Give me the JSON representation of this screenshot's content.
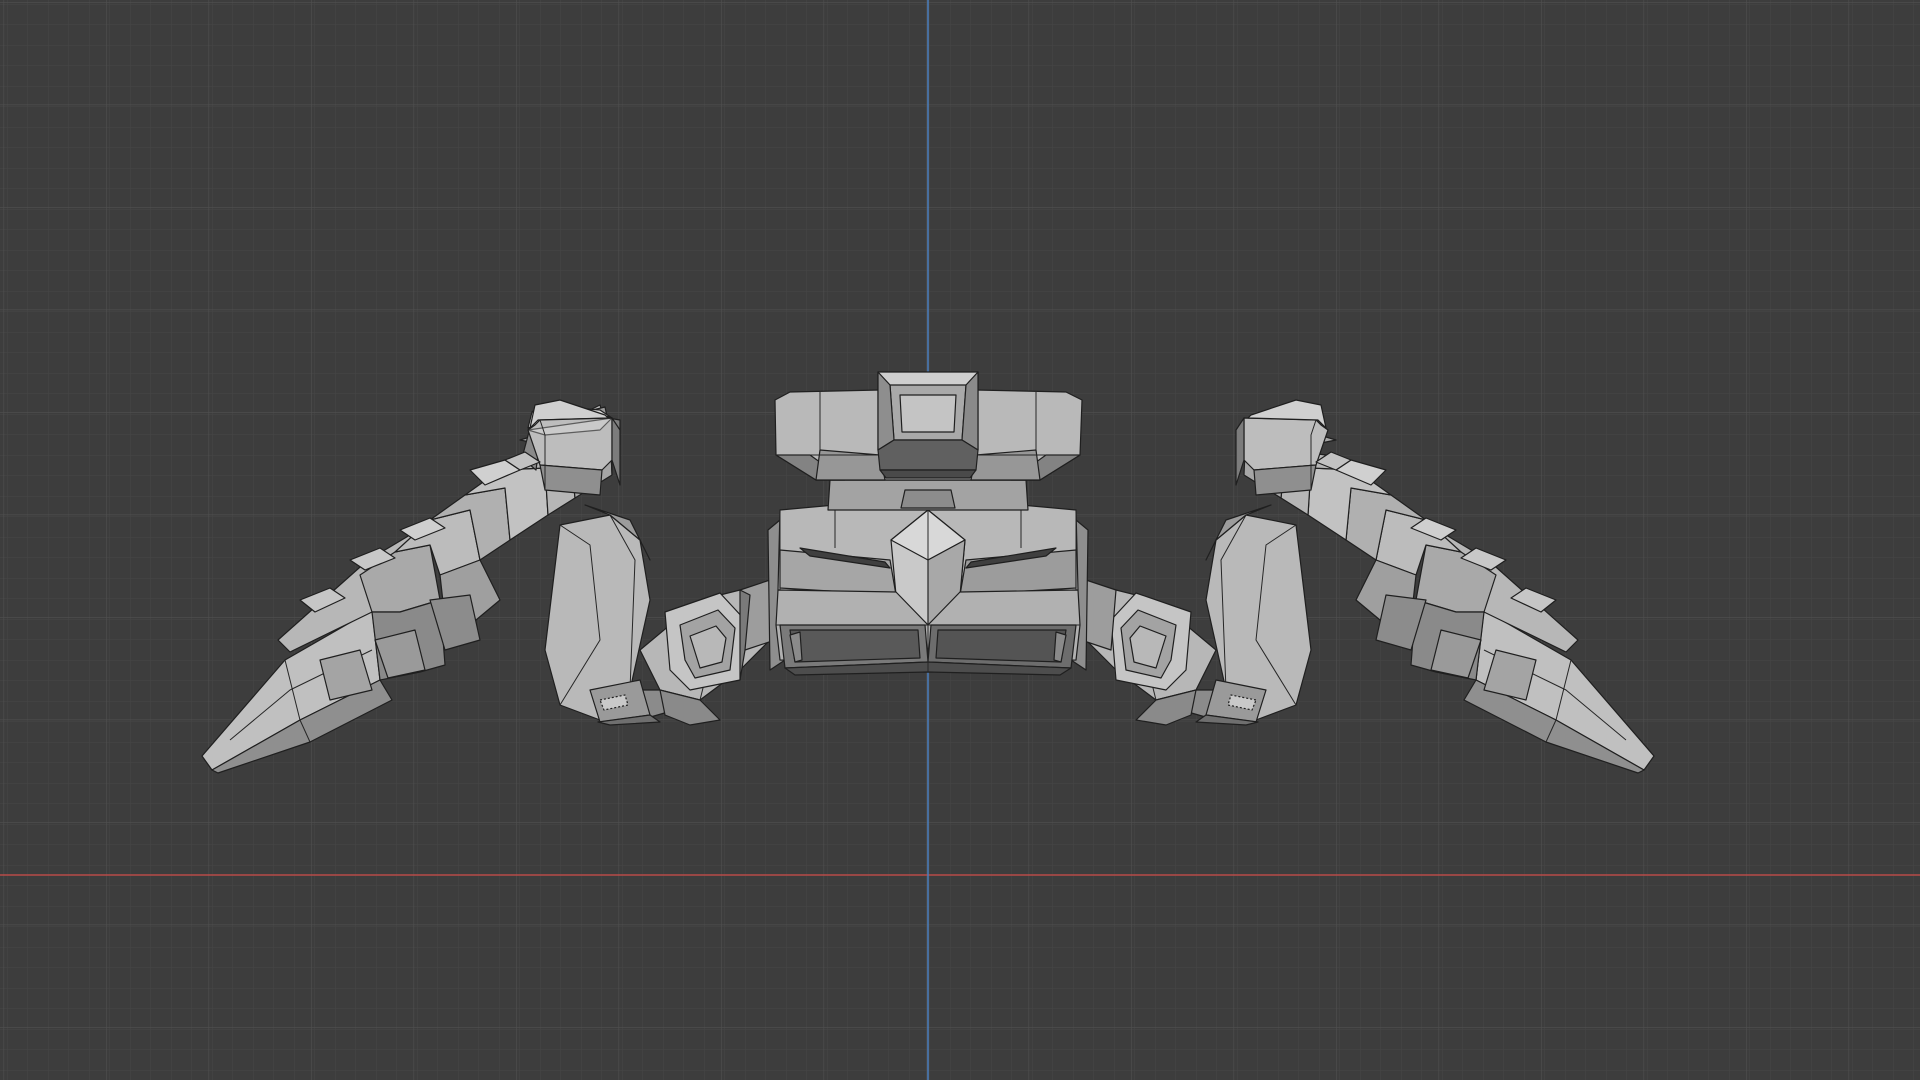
{
  "viewport": {
    "view": "front-orthographic",
    "grid": "on",
    "axes_visible": [
      "x-axis",
      "z-axis"
    ],
    "colors": {
      "background": "#3d3d3d",
      "grid_minor": "#464646",
      "grid_major": "#4f4f4f",
      "x_axis": "#c0504d",
      "z_axis": "#4a7ab5",
      "mesh_light": "#b4b4b4",
      "mesh_mid": "#9a9a9a",
      "mesh_dark": "#6c6c6c",
      "mesh_edge": "#1f1f1f"
    }
  },
  "model": {
    "object": "robot-spider-mesh",
    "parts": [
      "turret-head",
      "torso-body",
      "left-leg",
      "right-leg"
    ]
  }
}
